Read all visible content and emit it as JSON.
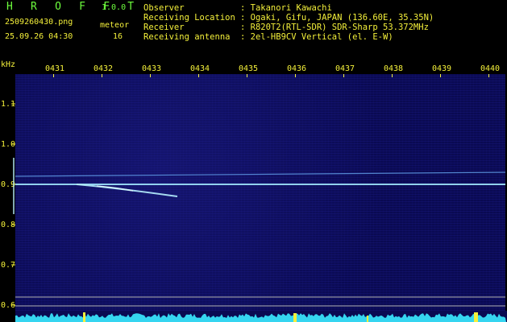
{
  "app": {
    "title": "H R O F F T",
    "version": "1.0.0",
    "filename": "2509260430.png",
    "meteor_label": "meteor",
    "meteor_count": "16",
    "datetime": "25.09.26 04:30"
  },
  "info": {
    "observer_label": "Observer",
    "observer_value": ": Takanori Kawachi",
    "location_label": "Receiving Location",
    "location_value": ": Ogaki, Gifu, JAPAN (136.60E, 35.35N)",
    "receiver_label": "Receiver",
    "receiver_value": ": R820T2(RTL-SDR) SDR-Sharp 53.372MHz",
    "antenna_label": "Receiving antenna",
    "antenna_value": ": 2el-HB9CV Vertical (el. E-W)"
  },
  "axis": {
    "unit": "kHz",
    "time_ticks": [
      "0431",
      "0432",
      "0433",
      "0434",
      "0435",
      "0436",
      "0437",
      "0438",
      "0439",
      "0440"
    ],
    "freq_ticks": [
      "1.1",
      "1.0",
      "0.9",
      "0.8",
      "0.7",
      "0.6"
    ]
  },
  "colors": {
    "title": "#6dfd3d",
    "labels": "#f4f03a",
    "info_text": "#e8e8e8",
    "background": "#0a0a52",
    "signal": "#a8e8ff",
    "spectrum": "#35d5f0"
  }
}
